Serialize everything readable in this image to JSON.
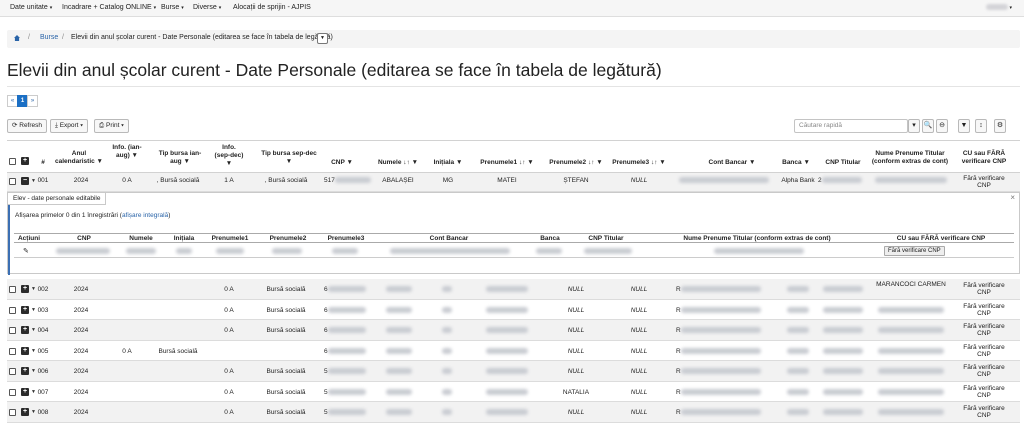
{
  "nav": {
    "items": [
      "Date unitate",
      "Incadrare + Catalog ONLINE",
      "Burse",
      "Diverse",
      "Alocații de sprijin - AJPIS"
    ],
    "caret": "▾",
    "user_caret": "▾"
  },
  "breadcrumb": {
    "sep": "/",
    "link": "Burse",
    "current": "Elevii din anul școlar curent - Date Personale (editarea se face în tabela de legătură)",
    "drop": "▼"
  },
  "page_title": "Elevii din anul școlar curent - Date Personale (editarea se face în tabela de legătură)",
  "pager": {
    "prev": "«",
    "page": "1",
    "next": "»"
  },
  "toolbar": {
    "refresh": "⟳ Refresh",
    "export": "Export ▾",
    "print": "Print ▾",
    "search_placeholder": "Căutare rapidă",
    "search_drop": "▾",
    "search_icon": "🔍",
    "zoom_icon": "⊖",
    "filter_icon": "▼",
    "sort_icon": "↕",
    "gear_icon": "⚙"
  },
  "table": {
    "headers": {
      "num": "#",
      "an": "Anul calendaristic ▼",
      "info1": "Info. (ian-aug) ▼",
      "tip1": "Tip bursa ian-aug ▼",
      "info2": "Info. (sep-dec) ▼",
      "tip2": "Tip bursa sep-dec ▼",
      "cnp": "CNP ▼",
      "nume": "Numele ↓↑ ▼",
      "init": "Inițiala ▼",
      "pren1": "Prenumele1 ↓↑ ▼",
      "pren2": "Prenumele2 ↓↑ ▼",
      "pren3": "Prenumele3 ↓↑ ▼",
      "cont": "Cont Bancar ▼",
      "banca": "Banca ▼",
      "cnpt": "CNP Titular",
      "npt": "Nume Prenume Titular (conform extras de cont)",
      "cu": "CU sau FĂRĂ verificare CNP"
    },
    "first_row": {
      "num": "001",
      "an": "2024",
      "info1": "0 A",
      "tip1": ", Bursă socială",
      "info2": "1 A",
      "tip2": ", Bursă socială",
      "cnp_prefix": "517",
      "nume": "ABALAȘEI",
      "init": "MG",
      "pren1": "MATEI",
      "pren2": "ȘTEFAN",
      "pren3": "NULL",
      "banca": "Alpha Bank",
      "cnpt_prefix": "2",
      "cu": "Fără verificare CNP"
    },
    "rows": [
      {
        "num": "002",
        "an": "2024",
        "info1": "",
        "tip1": "",
        "info2": "0 A",
        "tip2": "Bursă socială",
        "cnp_prefix": "6",
        "pren2": "NULL",
        "pren3": "NULL",
        "cont_prefix": "R",
        "npt": "MARANCOCI CARMEN",
        "cu": "Fără verificare CNP"
      },
      {
        "num": "003",
        "an": "2024",
        "info1": "",
        "tip1": "",
        "info2": "0 A",
        "tip2": "Bursă socială",
        "cnp_prefix": "6",
        "pren2": "NULL",
        "pren3": "NULL",
        "cont_prefix": "R",
        "npt": "",
        "cu": "Fără verificare CNP"
      },
      {
        "num": "004",
        "an": "2024",
        "info1": "",
        "tip1": "",
        "info2": "0 A",
        "tip2": "Bursă socială",
        "cnp_prefix": "6",
        "pren2": "NULL",
        "pren3": "NULL",
        "cont_prefix": "R",
        "npt": "",
        "cu": "Fără verificare CNP"
      },
      {
        "num": "005",
        "an": "2024",
        "info1": "0 A",
        "tip1": "Bursă socială",
        "info2": "",
        "tip2": "",
        "cnp_prefix": "6",
        "pren2": "NULL",
        "pren3": "NULL",
        "cont_prefix": "R",
        "npt": "",
        "cu": "Fără verificare CNP"
      },
      {
        "num": "006",
        "an": "2024",
        "info1": "",
        "tip1": "",
        "info2": "0 A",
        "tip2": "Bursă socială",
        "cnp_prefix": "5",
        "pren2": "NULL",
        "pren3": "NULL",
        "cont_prefix": "R",
        "npt": "",
        "cu": "Fără verificare CNP"
      },
      {
        "num": "007",
        "an": "2024",
        "info1": "",
        "tip1": "",
        "info2": "0 A",
        "tip2": "Bursă socială",
        "cnp_prefix": "5",
        "pren2": "NATALIA",
        "pren3": "NULL",
        "cont_prefix": "R",
        "npt": "",
        "cu": "Fără verificare CNP"
      },
      {
        "num": "008",
        "an": "2024",
        "info1": "",
        "tip1": "",
        "info2": "0 A",
        "tip2": "Bursă socială",
        "cnp_prefix": "5",
        "pren2": "NULL",
        "pren3": "NULL",
        "cont_prefix": "R",
        "npt": "",
        "cu": "Fără verificare CNP"
      }
    ]
  },
  "subpanel": {
    "tab": "Elev - date personale editabile",
    "close": "×",
    "info_pre": "Afișarea primelor 0 din 1 înregistrări (",
    "info_link": "afișare integrală",
    "info_post": ")",
    "headers": [
      "Acțiuni",
      "CNP",
      "Numele",
      "Inițiala",
      "Prenumele1",
      "Prenumele2",
      "Prenumele3",
      "Cont Bancar",
      "Banca",
      "CNP Titular",
      "Nume Prenume Titular (conform extras de cont)",
      "CU sau FĂRĂ verificare CNP"
    ],
    "pencil": "✎",
    "button": "Fără verificare CNP"
  }
}
